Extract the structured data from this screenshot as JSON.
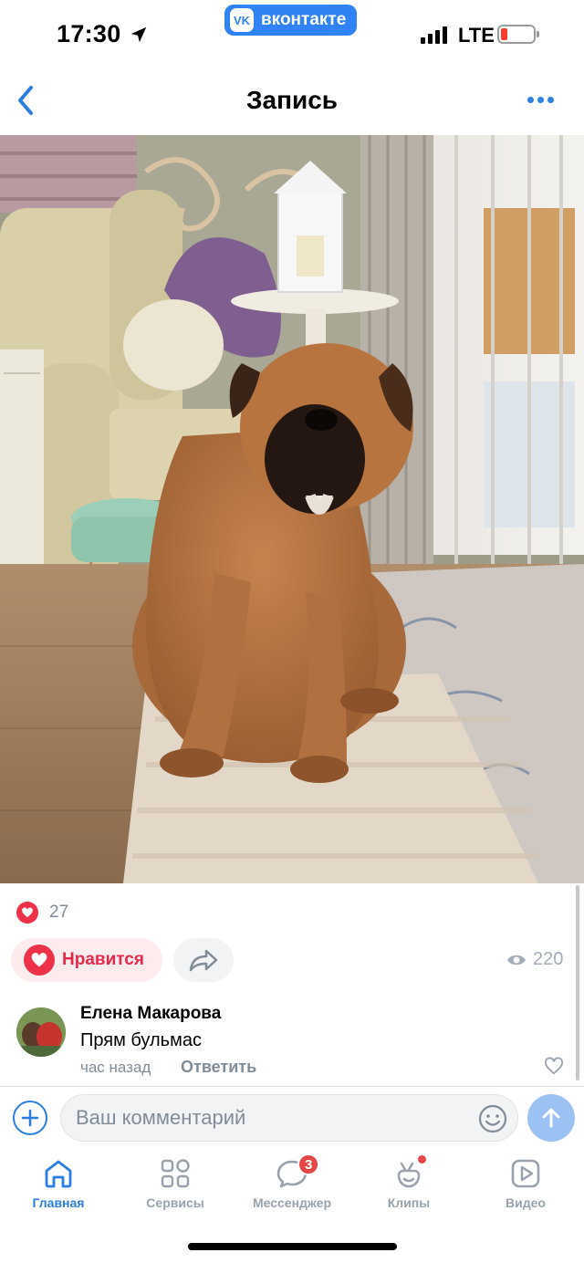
{
  "status_bar": {
    "time": "17:30",
    "app_pill": "вконтакте",
    "app_pill_logo": "VK",
    "network": "LTE",
    "battery": "low",
    "icons": [
      "location-arrow-icon",
      "signal-icon",
      "battery-icon"
    ]
  },
  "header": {
    "title": "Запись",
    "back_icon": "chevron-left-icon",
    "more_icon": "more-dots-icon"
  },
  "post": {
    "image": "large brown dog sitting on a white shaggy rug in a living room",
    "likes_count": "27",
    "like_button_label": "Нравится",
    "share_icon": "share-arrow-icon",
    "views_count": "220",
    "views_icon": "eye-icon"
  },
  "comment": {
    "author": "Елена Макарова",
    "text": "Прям бульмас",
    "time": "час назад",
    "reply_label": "Ответить",
    "like_icon": "heart-outline-icon"
  },
  "composer": {
    "placeholder": "Ваш комментарий",
    "add_icon": "plus-icon",
    "emoji_icon": "smile-icon",
    "send_icon": "send-arrow-icon"
  },
  "tabs": [
    {
      "label": "Главная",
      "icon": "home-icon",
      "active": true
    },
    {
      "label": "Сервисы",
      "icon": "services-icon"
    },
    {
      "label": "Мессенджер",
      "icon": "messenger-icon",
      "badge": "3"
    },
    {
      "label": "Клипы",
      "icon": "clips-icon",
      "dot": true
    },
    {
      "label": "Видео",
      "icon": "video-icon"
    }
  ],
  "colors": {
    "accent": "#2b7ee0",
    "like": "#ec3148",
    "vk_blue": "#2f83f5",
    "secondary_text": "#818c99"
  }
}
